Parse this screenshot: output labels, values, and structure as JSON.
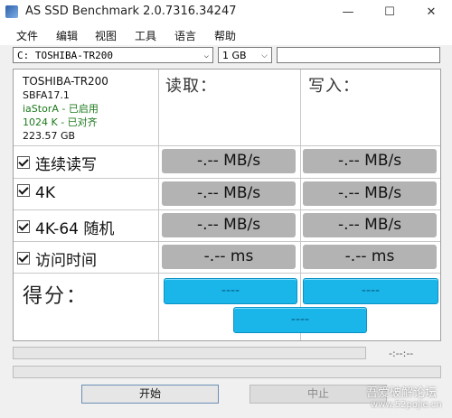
{
  "window": {
    "title": "AS SSD Benchmark 2.0.7316.34247",
    "minimize": "—",
    "maximize": "☐",
    "close": "✕"
  },
  "menu": [
    "文件",
    "编辑",
    "视图",
    "工具",
    "语言",
    "帮助"
  ],
  "toolbar": {
    "drive_value": "C: TOSHIBA-TR200",
    "size_value": "1 GB",
    "text_value": ""
  },
  "drive_info": {
    "model": "TOSHIBA-TR200",
    "firmware": "SBFA17.1",
    "driver": "iaStorA - 已启用",
    "alignment": "1024 K - 已对齐",
    "capacity": "223.57 GB"
  },
  "headers": {
    "read": "读取：",
    "write": "写入："
  },
  "rows": [
    {
      "label": "连续读写",
      "read": "-.-- MB/s",
      "write": "-.-- MB/s"
    },
    {
      "label": "4K",
      "read": "-.-- MB/s",
      "write": "-.-- MB/s"
    },
    {
      "label": "4K-64 随机",
      "read": "-.-- MB/s",
      "write": "-.-- MB/s"
    },
    {
      "label": "访问时间",
      "read": "-.-- ms",
      "write": "-.-- ms"
    }
  ],
  "score": {
    "label": "得分：",
    "read": "----",
    "write": "----",
    "total": "----"
  },
  "status": {
    "time": "-:--:--"
  },
  "buttons": {
    "start": "开始",
    "stop": "中止"
  },
  "watermark": {
    "line1": "吾爱破解论坛",
    "line2": "www.52pojie.cn"
  },
  "colors": {
    "score_accent": "#1ab6ea",
    "result_gray": "#b3b3b3",
    "info_green": "#1c7a1c"
  }
}
